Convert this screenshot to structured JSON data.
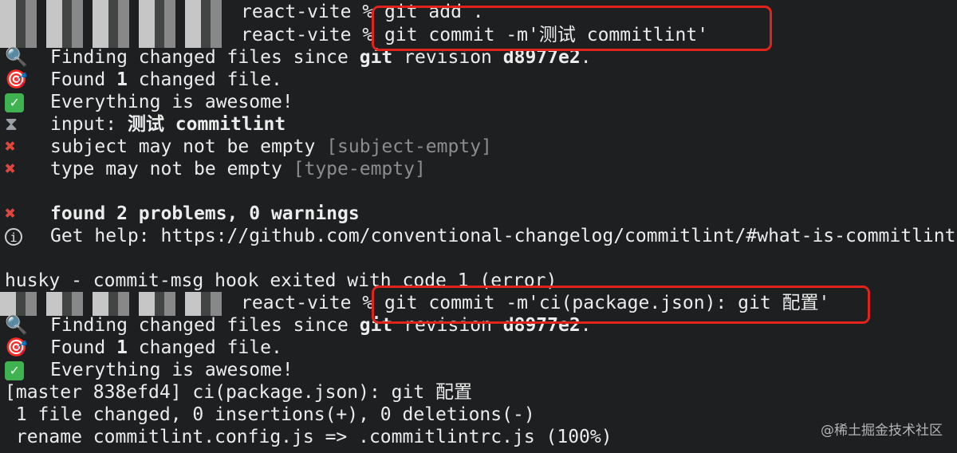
{
  "lines": {
    "l1": {
      "prompt": "react-vite % ",
      "command": "git add ."
    },
    "l2": {
      "prompt": "react-vite % ",
      "command": "git commit -m'测试 commitlint'"
    },
    "l3": {
      "icon": "magnifier-icon",
      "prefix": "Finding changed files since ",
      "bold": "git",
      "mid": " revision ",
      "bold2": "d8977e2",
      "suffix": "."
    },
    "l4": {
      "icon": "target-icon",
      "prefix": "Found ",
      "bold": "1",
      "suffix": " changed file."
    },
    "l5": {
      "icon": "check-icon",
      "text": "Everything is awesome!"
    },
    "l6": {
      "icon": "hourglass-icon",
      "prefix": "input: ",
      "bold": "测试 commitlint"
    },
    "l7": {
      "icon": "cross-icon",
      "text": "subject may not be empty ",
      "tag": "[subject-empty]"
    },
    "l8": {
      "icon": "cross-icon",
      "text": "type may not be empty ",
      "tag": "[type-empty]"
    },
    "l9": {
      "icon": "cross-icon",
      "bold": "found 2 problems, 0 warnings"
    },
    "l10": {
      "icon": "info-icon",
      "text": "Get help: https://github.com/conventional-changelog/commitlint/#what-is-commitlint"
    },
    "l11": {
      "text": "husky - commit-msg hook exited with code 1 (error)"
    },
    "l12": {
      "prompt": "react-vite % ",
      "command": "git commit -m'ci(package.json): git 配置'"
    },
    "l13": {
      "icon": "magnifier-icon",
      "prefix": "Finding changed files since ",
      "bold": "git",
      "mid": " revision ",
      "bold2": "d8977e2",
      "suffix": "."
    },
    "l14": {
      "icon": "target-icon",
      "prefix": "Found ",
      "bold": "1",
      "suffix": " changed file."
    },
    "l15": {
      "icon": "check-icon",
      "text": "Everything is awesome!"
    },
    "l16": {
      "text": "[master 838efd4] ci(package.json): git 配置"
    },
    "l17": {
      "text": " 1 file changed, 0 insertions(+), 0 deletions(-)"
    },
    "l18": {
      "text": " rename commitlint.config.js => .commitlintrc.js (100%)"
    }
  },
  "watermark": "@稀土掘金技术社区",
  "colors": {
    "background": "#1d1f21",
    "foreground": "#ececec",
    "highlight_box": "#e0241c",
    "error_icon": "#e2453c",
    "success_icon": "#3fb34f",
    "dim_text": "#8d8d8d"
  }
}
